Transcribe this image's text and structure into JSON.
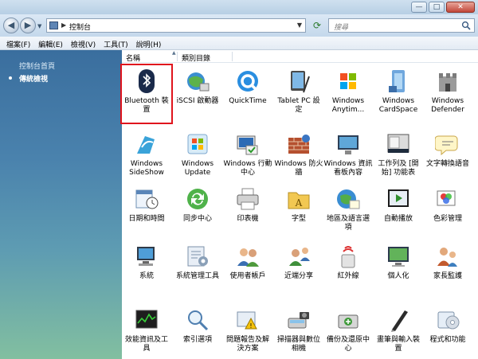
{
  "window": {
    "ghost_title": "",
    "buttons": [
      "—",
      "□",
      "✕"
    ]
  },
  "address": {
    "path": "控制台",
    "search_placeholder": "搜尋"
  },
  "menu": [
    "檔案(F)",
    "編輯(E)",
    "檢視(V)",
    "工具(T)",
    "說明(H)"
  ],
  "sidebar": {
    "links": [
      "控制台首頁",
      "傳統檢視"
    ]
  },
  "columns": [
    "名稱",
    "類別目錄"
  ],
  "items": [
    {
      "label": "Bluetooth 裝置",
      "icon": "bluetooth-icon",
      "selected": true
    },
    {
      "label": "iSCSI 啟動器",
      "icon": "iscsi-globe-icon"
    },
    {
      "label": "QuickTime",
      "icon": "quicktime-icon"
    },
    {
      "label": "Tablet PC 設定",
      "icon": "tablet-pc-icon"
    },
    {
      "label": "Windows Anytim...",
      "icon": "windows-flag-icon"
    },
    {
      "label": "Windows CardSpace",
      "icon": "cardspace-icon"
    },
    {
      "label": "Windows Defender",
      "icon": "defender-castle-icon"
    },
    {
      "label": "Windows SideShow",
      "icon": "sideshow-icon"
    },
    {
      "label": "Windows Update",
      "icon": "windows-update-icon"
    },
    {
      "label": "Windows 行動中心",
      "icon": "mobility-center-icon"
    },
    {
      "label": "Windows 防火牆",
      "icon": "firewall-icon"
    },
    {
      "label": "Windows 資訊看板內容",
      "icon": "sidebar-gadget-icon"
    },
    {
      "label": "工作列及 [開始] 功能表",
      "icon": "taskbar-icon"
    },
    {
      "label": "文字轉換語音",
      "icon": "speech-icon"
    },
    {
      "label": "日期和時間",
      "icon": "calendar-clock-icon"
    },
    {
      "label": "同步中心",
      "icon": "sync-center-icon"
    },
    {
      "label": "印表機",
      "icon": "printer-icon"
    },
    {
      "label": "字型",
      "icon": "fonts-folder-icon"
    },
    {
      "label": "地區及語言選項",
      "icon": "region-globe-icon"
    },
    {
      "label": "自動播放",
      "icon": "autoplay-icon"
    },
    {
      "label": "色彩管理",
      "icon": "color-management-icon"
    },
    {
      "label": "系統",
      "icon": "system-computer-icon"
    },
    {
      "label": "系統管理工具",
      "icon": "admin-tools-icon"
    },
    {
      "label": "使用者帳戶",
      "icon": "user-accounts-icon"
    },
    {
      "label": "近端分享",
      "icon": "people-near-me-icon"
    },
    {
      "label": "紅外線",
      "icon": "infrared-icon"
    },
    {
      "label": "個人化",
      "icon": "personalization-icon"
    },
    {
      "label": "家長監護",
      "icon": "parental-controls-icon"
    },
    {
      "label": "效能資訊及工具",
      "icon": "performance-icon"
    },
    {
      "label": "索引選項",
      "icon": "indexing-icon"
    },
    {
      "label": "問題報告及解決方案",
      "icon": "problem-reports-icon"
    },
    {
      "label": "掃描器與數位相機",
      "icon": "scanner-camera-icon"
    },
    {
      "label": "備份及還原中心",
      "icon": "backup-restore-icon"
    },
    {
      "label": "畫筆與輸入裝置",
      "icon": "pen-input-icon"
    },
    {
      "label": "程式和功能",
      "icon": "programs-features-icon"
    }
  ]
}
